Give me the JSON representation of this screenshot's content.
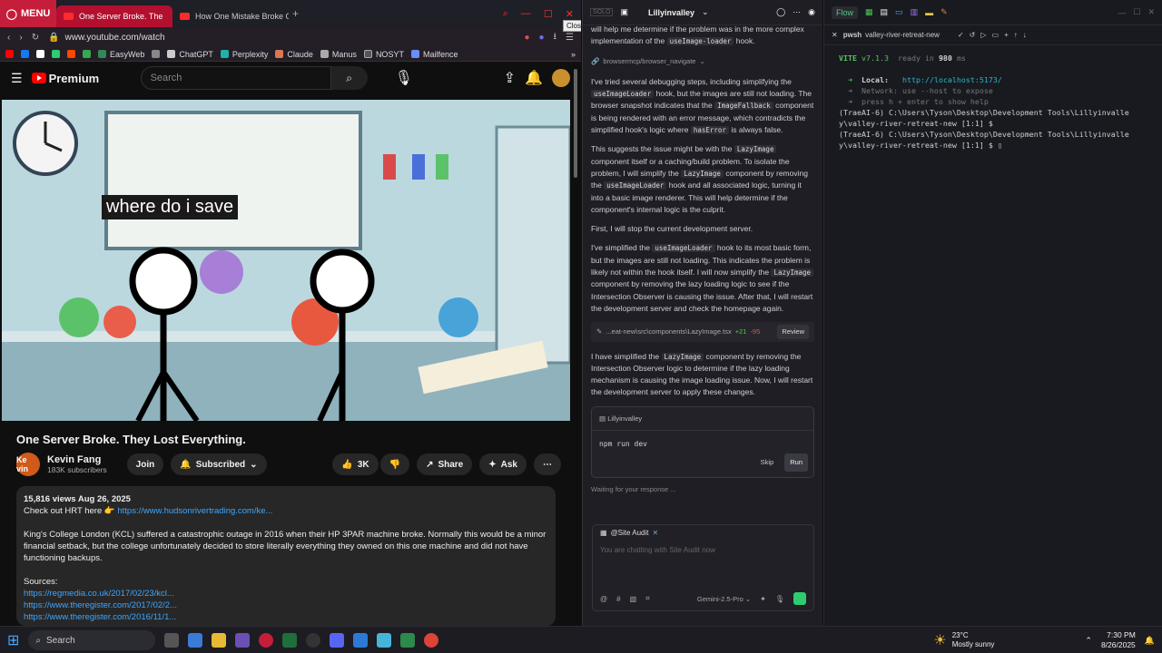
{
  "browser": {
    "menu_label": "MENU",
    "tabs": [
      {
        "label": "One Server Broke. The"
      },
      {
        "label": "How One Mistake Broke C"
      }
    ],
    "close_tooltip": "Close",
    "url": "www.youtube.com/watch",
    "bookmarks": [
      "EasyWeb",
      "ChatGPT",
      "Perplexity",
      "Claude",
      "Manus",
      "NOSYT",
      "Mailfence"
    ]
  },
  "youtube": {
    "logo": "Premium",
    "search_placeholder": "Search",
    "caption": "where do i save",
    "title": "One Server Broke. They Lost Everything.",
    "channel": "Kevin Fang",
    "avatar_text": "Ke vin",
    "subscribers": "183K subscribers",
    "join": "Join",
    "subscribed": "Subscribed",
    "likes": "3K",
    "share": "Share",
    "ask": "Ask",
    "views_date": "15,816 views  Aug 26, 2025",
    "promo_text": "Check out HRT here 👉",
    "promo_link": "https://www.hudsonrivertrading.com/ke...",
    "description": "King's College London (KCL) suffered a catastrophic outage in 2016 when their HP 3PAR machine broke. Normally this would be a minor financial setback, but the college unfortunately decided to store literally everything they owned on this one machine and did not have functioning backups.",
    "sources_label": "Sources:",
    "sources": [
      "https://regmedia.co.uk/2017/02/23/kcl...",
      "https://www.theregister.com/2017/02/2...",
      "https://www.theregister.com/2016/11/1..."
    ]
  },
  "ide": {
    "status": "SOLO",
    "project": "Lillyinvalley",
    "flow": "Flow",
    "intro_text": "will help me determine if the problem was in the more complex implementation of the",
    "intro_code": "useImage-loader",
    "intro_tail": "hook.",
    "tool_ref": "browsermcp/browser_navigate",
    "p1": [
      "I've tried several debugging steps, including simplifying the",
      "useImageLoader",
      "hook, but the images are still not loading. The browser snapshot indicates that the",
      "ImageFallback",
      "component is being rendered with an error message, which contradicts the simplified hook's logic where",
      "hasError",
      "is always false."
    ],
    "p2": [
      "This suggests the issue might be with the",
      "LazyImage",
      "component itself or a caching/build problem. To isolate the problem, I will simplify the",
      "LazyImage",
      "component by removing the",
      "useImageLoader",
      "hook and all associated logic, turning it into a basic image renderer. This will help determine if the component's internal logic is the culprit."
    ],
    "p3": "First, I will stop the current development server.",
    "p4": [
      "I've simplified the",
      "useImageLoader",
      "hook to its most basic form, but the images are still not loading. This indicates the problem is likely not within the hook itself. I will now simplify the",
      "LazyImage",
      "component by removing the lazy loading logic to see if the Intersection Observer is causing the issue. After that, I will restart the development server and check the homepage again."
    ],
    "file_chip": "...eat-new\\src\\components\\LazyImage.tsx",
    "added": "+21",
    "removed": "-95",
    "review": "Review",
    "p5": [
      "I have simplified the",
      "LazyImage",
      "component by removing the Intersection Observer logic to determine if the lazy loading mechanism is causing the image loading issue. Now, I will restart the development server to apply these changes."
    ],
    "cmd_header": "Lillyinvalley",
    "command": "npm run dev",
    "skip": "Skip",
    "run": "Run",
    "waiting": "Waiting for your response ...",
    "agent": "@Site Audit",
    "chat_placeholder": "You are chatting with Site Audit now",
    "model": "Gemini-2.5-Pro"
  },
  "terminal": {
    "tab": "pwsh",
    "title": "valley-river-retreat-new",
    "vite_name": "VITE",
    "vite_ver": "v7.1.3",
    "ready_text": "ready in",
    "ready_ms": "980",
    "ms": "ms",
    "local_label": "Local:",
    "local_url": "http://localhost:5173/",
    "network_line": "Network: use --host to expose",
    "help_line": "press h + enter to show help",
    "prompt1": "(TraeAI-6) C:\\Users\\Tyson\\Desktop\\Development Tools\\Lillyinvalle",
    "prompt1b": "y\\valley-river-retreat-new [1:1] $",
    "prompt2": "(TraeAI-6) C:\\Users\\Tyson\\Desktop\\Development Tools\\Lillyinvalle",
    "prompt2b": "y\\valley-river-retreat-new [1:1] $"
  },
  "taskbar": {
    "search": "Search",
    "temp": "23°C",
    "weather": "Mostly sunny",
    "time": "7:30 PM",
    "date": "8/26/2025"
  }
}
